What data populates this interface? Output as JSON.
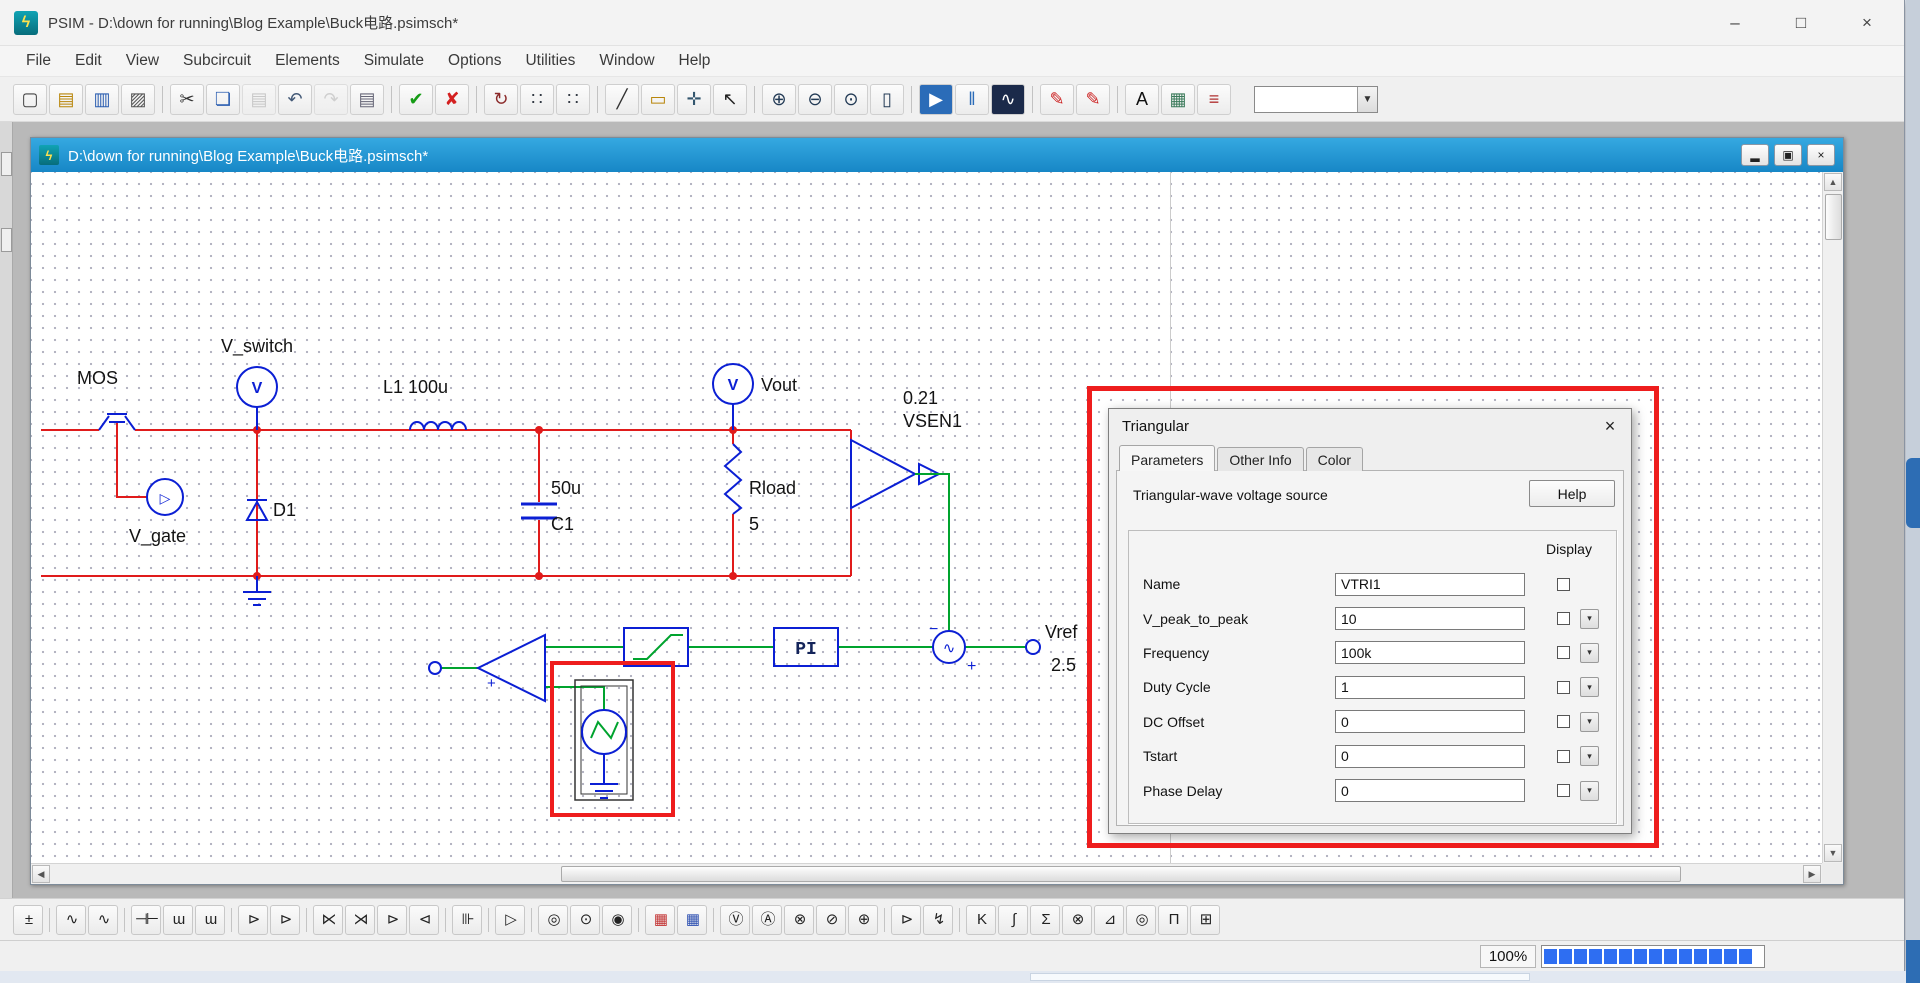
{
  "window": {
    "title": "PSIM - D:\\down for running\\Blog Example\\Buck电路.psimsch*"
  },
  "menu": {
    "items": [
      "File",
      "Edit",
      "View",
      "Subcircuit",
      "Elements",
      "Simulate",
      "Options",
      "Utilities",
      "Window",
      "Help"
    ]
  },
  "toolbar": {
    "groups": [
      [
        {
          "name": "new-file",
          "glyph": "▢",
          "color": "#444"
        },
        {
          "name": "open-file",
          "glyph": "▤",
          "color": "#b8860b"
        },
        {
          "name": "save-file",
          "glyph": "▥",
          "color": "#2a5db0"
        },
        {
          "name": "print",
          "glyph": "▨",
          "color": "#555"
        }
      ],
      [
        {
          "name": "cut",
          "glyph": "✂",
          "color": "#333"
        },
        {
          "name": "copy",
          "glyph": "❏",
          "color": "#2a5db0"
        },
        {
          "name": "paste",
          "glyph": "▤",
          "color": "#a8a8a8",
          "disabled": true
        },
        {
          "name": "undo",
          "glyph": "↶",
          "color": "#445a77"
        },
        {
          "name": "redo",
          "glyph": "↷",
          "color": "#b5b5b5",
          "disabled": true
        },
        {
          "name": "clipboard-view",
          "glyph": "▤",
          "color": "#667"
        }
      ],
      [
        {
          "name": "run-check",
          "glyph": "✔",
          "color": "#169c16"
        },
        {
          "name": "cancel-check",
          "glyph": "✘",
          "color": "#d42020"
        }
      ],
      [
        {
          "name": "rotate",
          "glyph": "↻",
          "color": "#8b2a2a"
        },
        {
          "name": "wire-mode",
          "glyph": "∷",
          "color": "#333a44"
        },
        {
          "name": "assign-node",
          "glyph": "∷",
          "color": "#333a44"
        }
      ],
      [
        {
          "name": "draw-wire",
          "glyph": "╱",
          "color": "#333"
        },
        {
          "name": "place-label",
          "glyph": "▭",
          "color": "#b8860b"
        },
        {
          "name": "pan",
          "glyph": "✛",
          "color": "#33566e"
        },
        {
          "name": "select",
          "glyph": "↖",
          "color": "#222"
        }
      ],
      [
        {
          "name": "zoom-in",
          "glyph": "⊕",
          "color": "#223a55"
        },
        {
          "name": "zoom-out",
          "glyph": "⊖",
          "color": "#223a55"
        },
        {
          "name": "zoom-area",
          "glyph": "⊙",
          "color": "#223a55"
        },
        {
          "name": "fit-page",
          "glyph": "▯",
          "color": "#223a55"
        }
      ],
      [
        {
          "name": "run-simulation",
          "glyph": "▶",
          "color": "#ffffff",
          "bg": "#2b6cb8"
        },
        {
          "name": "pause-simulation",
          "glyph": "‖",
          "color": "#2b6cb8"
        },
        {
          "name": "view-waveform",
          "glyph": "∿",
          "color": "#ffffff",
          "bg": "#1b2a4a"
        }
      ],
      [
        {
          "name": "voltage-probe-tool",
          "glyph": "✎",
          "color": "#c22"
        },
        {
          "name": "current-probe-tool",
          "glyph": "✎",
          "color": "#c22"
        }
      ],
      [
        {
          "name": "text-tool",
          "glyph": "A",
          "color": "#111"
        },
        {
          "name": "element-list",
          "glyph": "▦",
          "color": "#3a7a5a"
        },
        {
          "name": "netlist",
          "glyph": "≡",
          "color": "#b03030"
        }
      ]
    ],
    "combo_value": ""
  },
  "child": {
    "title": "D:\\down for running\\Blog Example\\Buck电路.psimsch*"
  },
  "circuit": {
    "mos_label": "MOS",
    "v_switch_label": "V_switch",
    "probe_v": "V",
    "l1_label": "L1 100u",
    "vout_label": "Vout",
    "vsen_value": "0.21",
    "vsen_name": "VSEN1",
    "c1_value": "50u",
    "c1_name": "C1",
    "rload_name": "Rload",
    "rload_value": "5",
    "d1_label": "D1",
    "v_gate_label": "V_gate",
    "pi_label": "PI",
    "vref_label": "Vref",
    "vref_value": "2.5"
  },
  "dialog": {
    "title": "Triangular",
    "tabs": [
      "Parameters",
      "Other Info",
      "Color"
    ],
    "active_tab": "Parameters",
    "description": "Triangular-wave voltage source",
    "help_label": "Help",
    "display_label": "Display",
    "fields": [
      {
        "label": "Name",
        "value": "VTRI1",
        "has_dropdown": false
      },
      {
        "label": "V_peak_to_peak",
        "value": "10",
        "has_dropdown": true
      },
      {
        "label": "Frequency",
        "value": "100k",
        "has_dropdown": true
      },
      {
        "label": "Duty Cycle",
        "value": "1",
        "has_dropdown": true
      },
      {
        "label": "DC Offset",
        "value": "0",
        "has_dropdown": true
      },
      {
        "label": "Tstart",
        "value": "0",
        "has_dropdown": true
      },
      {
        "label": "Phase Delay",
        "value": "0",
        "has_dropdown": true
      }
    ]
  },
  "element_toolbar": {
    "groups": [
      [
        {
          "name": "dc-source",
          "glyph": "±",
          "color": "#222"
        }
      ],
      [
        {
          "name": "resistor",
          "glyph": "∿",
          "color": "#222"
        },
        {
          "name": "rheostat",
          "glyph": "∿",
          "color": "#222"
        }
      ],
      [
        {
          "name": "capacitor",
          "glyph": "⊣⊢",
          "color": "#222"
        },
        {
          "name": "inductor",
          "glyph": "ɯ",
          "color": "#222"
        },
        {
          "name": "coupled-inductor",
          "glyph": "ɯ",
          "color": "#222"
        }
      ],
      [
        {
          "name": "diode",
          "glyph": "⊳",
          "color": "#222"
        },
        {
          "name": "zener-diode",
          "glyph": "⊳",
          "color": "#222"
        }
      ],
      [
        {
          "name": "mosfet",
          "glyph": "⋉",
          "color": "#222"
        },
        {
          "name": "igbt",
          "glyph": "⋊",
          "color": "#222"
        },
        {
          "name": "thyristor",
          "glyph": "⊳",
          "color": "#222"
        },
        {
          "name": "triac",
          "glyph": "⊲",
          "color": "#222"
        }
      ],
      [
        {
          "name": "transformer",
          "glyph": "⊪",
          "color": "#222"
        }
      ],
      [
        {
          "name": "op-amp",
          "glyph": "▷",
          "color": "#222"
        }
      ],
      [
        {
          "name": "node-probe",
          "glyph": "◎",
          "color": "#222"
        },
        {
          "name": "voltage-source",
          "glyph": "⊙",
          "color": "#222"
        },
        {
          "name": "current-source",
          "glyph": "◉",
          "color": "#222"
        }
      ],
      [
        {
          "name": "scope-red",
          "glyph": "▦",
          "color": "#c23030"
        },
        {
          "name": "scope-blue",
          "glyph": "▦",
          "color": "#2a4db0"
        }
      ],
      [
        {
          "name": "voltmeter",
          "glyph": "Ⓥ",
          "color": "#222"
        },
        {
          "name": "ammeter",
          "glyph": "Ⓐ",
          "color": "#222"
        },
        {
          "name": "wattmeter",
          "glyph": "⊗",
          "color": "#222"
        },
        {
          "name": "var-meter",
          "glyph": "⊘",
          "color": "#222"
        },
        {
          "name": "frequency-meter",
          "glyph": "⊕",
          "color": "#222"
        }
      ],
      [
        {
          "name": "gating-block",
          "glyph": "⊳",
          "color": "#222"
        },
        {
          "name": "on-off-controller",
          "glyph": "↯",
          "color": "#222"
        }
      ],
      [
        {
          "name": "gain-block",
          "glyph": "K",
          "color": "#222"
        },
        {
          "name": "integrator",
          "glyph": "∫",
          "color": "#222"
        },
        {
          "name": "summer",
          "glyph": "Σ",
          "color": "#222"
        },
        {
          "name": "multiplier",
          "glyph": "⊗",
          "color": "#222"
        },
        {
          "name": "limiter",
          "glyph": "⊿",
          "color": "#222"
        },
        {
          "name": "sensor",
          "glyph": "◎",
          "color": "#222"
        },
        {
          "name": "filter",
          "glyph": "Π",
          "color": "#222"
        },
        {
          "name": "function-block",
          "glyph": "⊞",
          "color": "#222"
        }
      ]
    ]
  },
  "statusbar": {
    "zoom_label": "100%",
    "progress_segments": 14
  }
}
